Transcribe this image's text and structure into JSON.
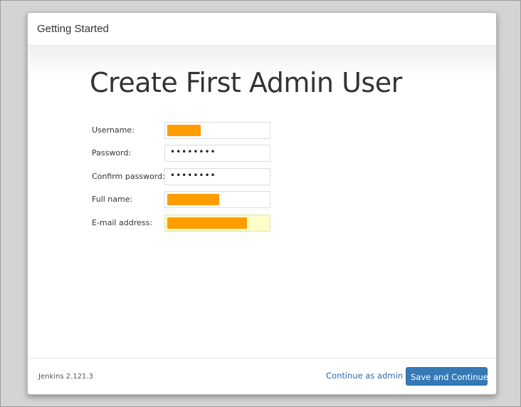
{
  "dialog": {
    "title": "Getting Started",
    "heading": "Create First Admin User"
  },
  "form": {
    "fields": [
      {
        "label": "Username:",
        "value_redacted": true
      },
      {
        "label": "Password:",
        "masked_value": "••••••••"
      },
      {
        "label": "Confirm password:",
        "masked_value": "••••••••"
      },
      {
        "label": "Full name:",
        "value_redacted": true
      },
      {
        "label": "E-mail address:",
        "value_redacted": true,
        "autofilled": true
      }
    ]
  },
  "footer": {
    "version": "Jenkins 2.121.3",
    "continue_as_admin_label": "Continue as admin",
    "save_and_continue_label": "Save and Continue"
  },
  "colors": {
    "primary_button": "#3579b7",
    "link": "#2b6aa6",
    "redaction": "#ff9d00",
    "autofill_background": "#fbfcc7"
  }
}
